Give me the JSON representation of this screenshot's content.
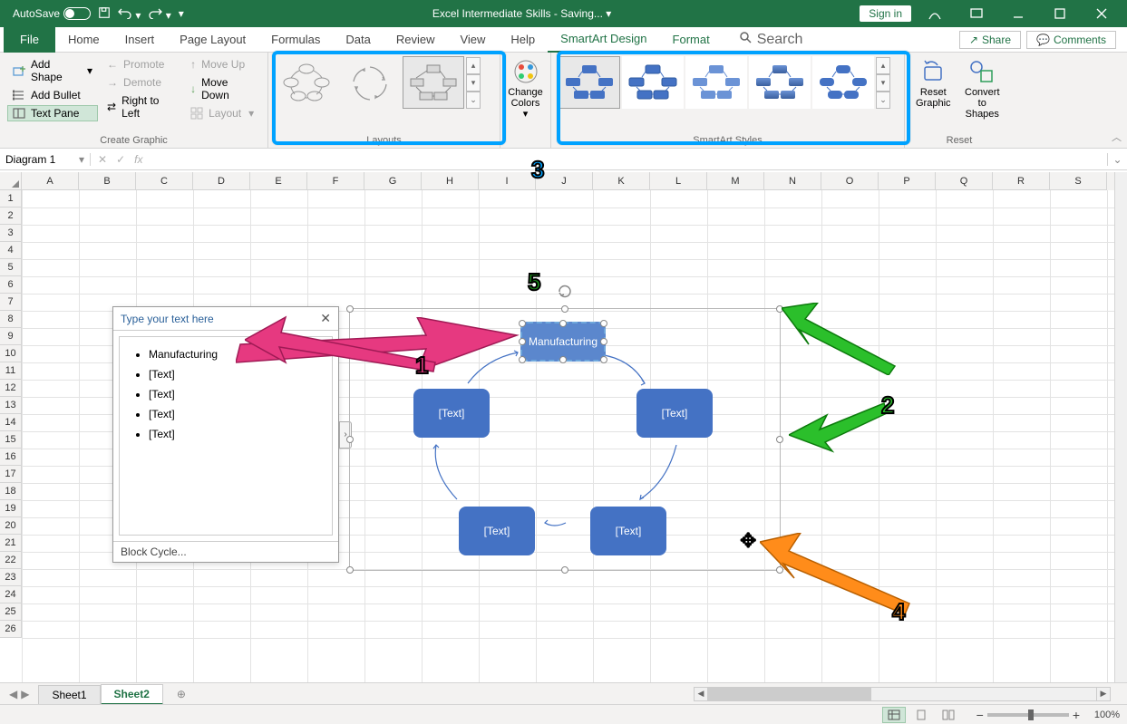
{
  "titlebar": {
    "autosave_label": "AutoSave",
    "autosave_state": "Off",
    "doc_title": "Excel Intermediate Skills",
    "saving_text": "Saving...",
    "separator": "  -  ",
    "signin_label": "Sign in"
  },
  "ribbon": {
    "tabs": [
      "File",
      "Home",
      "Insert",
      "Page Layout",
      "Formulas",
      "Data",
      "Review",
      "View",
      "Help",
      "SmartArt Design",
      "Format"
    ],
    "active_tab": "SmartArt Design",
    "search_placeholder": "Search",
    "share_label": "Share",
    "comments_label": "Comments",
    "groups": {
      "create_graphic": {
        "label": "Create Graphic",
        "add_shape": "Add Shape",
        "add_bullet": "Add Bullet",
        "text_pane": "Text Pane",
        "promote": "Promote",
        "demote": "Demote",
        "right_to_left": "Right to Left",
        "move_up": "Move Up",
        "move_down": "Move Down",
        "layout": "Layout"
      },
      "layouts": {
        "label": "Layouts"
      },
      "change_colors": {
        "label": "Change",
        "label2": "Colors"
      },
      "styles": {
        "label": "SmartArt Styles"
      },
      "reset": {
        "label": "Reset",
        "reset_graphic": "Reset",
        "reset_graphic2": "Graphic",
        "convert": "Convert",
        "convert2": "to Shapes"
      }
    }
  },
  "fxbar": {
    "namebox": "Diagram 1",
    "fx_label": "fx"
  },
  "columns": [
    "A",
    "B",
    "C",
    "D",
    "E",
    "F",
    "G",
    "H",
    "I",
    "J",
    "K",
    "L",
    "M",
    "N",
    "O",
    "P",
    "Q",
    "R",
    "S"
  ],
  "rows": 26,
  "textpane": {
    "header": "Type your text here",
    "items": [
      "Manufacturing",
      "[Text]",
      "[Text]",
      "[Text]",
      "[Text]"
    ],
    "footer": "Block Cycle..."
  },
  "smartart": {
    "shapes": [
      {
        "label": "Manufacturing",
        "selected": true
      },
      {
        "label": "[Text]"
      },
      {
        "label": "[Text]"
      },
      {
        "label": "[Text]"
      },
      {
        "label": "[Text]"
      }
    ]
  },
  "sheets": {
    "tabs": [
      "Sheet1",
      "Sheet2"
    ],
    "active": "Sheet2"
  },
  "statusbar": {
    "zoom": "100%"
  },
  "annotations": {
    "n1": "1",
    "n2": "2",
    "n3": "3",
    "n4": "4",
    "n5": "5"
  }
}
